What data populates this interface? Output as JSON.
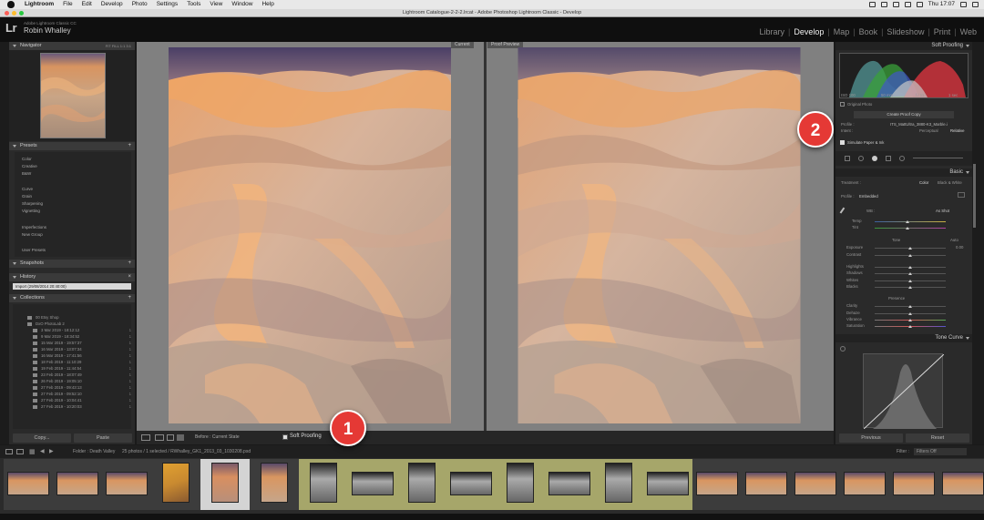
{
  "menubar": {
    "app": "Lightroom",
    "items": [
      "File",
      "Edit",
      "Develop",
      "Photo",
      "Settings",
      "Tools",
      "View",
      "Window",
      "Help"
    ],
    "clock": "Thu 17:07"
  },
  "window": {
    "title": "Lightroom Catalogue-2-2-2.lrcat - Adobe Photoshop Lightroom Classic - Develop"
  },
  "identity": {
    "logo": "Lr",
    "product": "Adobe Lightroom Classic CC",
    "user": "Robin Whalley"
  },
  "modules": [
    "Library",
    "Develop",
    "Map",
    "Book",
    "Slideshow",
    "Print",
    "Web"
  ],
  "active_module": "Develop",
  "left_panel": {
    "navigator": {
      "title": "Navigator",
      "zoom": "FIT   FILL   1:1   3:1"
    },
    "presets": {
      "title": "Presets",
      "groups": [
        [
          "Color",
          "Creative",
          "B&W"
        ],
        [
          "Curve",
          "Grain",
          "Sharpening",
          "Vignetting"
        ],
        [
          "Imperfections",
          "New Group"
        ],
        [
          "User Presets"
        ]
      ]
    },
    "snapshots": {
      "title": "Snapshots"
    },
    "history": {
      "title": "History",
      "item": "Import (29/08/2014 20:40:00)"
    },
    "collections": {
      "title": "Collections",
      "sets": [
        "00 Etsy Shop",
        "DxO PhotoLab 2"
      ],
      "items": [
        {
          "name": "3 Mar 2019 - 18:12:12",
          "count": "1"
        },
        {
          "name": "9 Mar 2019 - 18:34:52",
          "count": "1"
        },
        {
          "name": "15 Mar 2019 - 19:57:37",
          "count": "1"
        },
        {
          "name": "16 Mar 2019 - 13:07:34",
          "count": "1"
        },
        {
          "name": "16 Mar 2019 - 17:41:56",
          "count": "1"
        },
        {
          "name": "18 Feb 2019 - 11:10:29",
          "count": "1"
        },
        {
          "name": "19 Feb 2019 - 11:44:54",
          "count": "1"
        },
        {
          "name": "23 Feb 2019 - 18:07:49",
          "count": "1"
        },
        {
          "name": "26 Feb 2019 - 19:05:10",
          "count": "1"
        },
        {
          "name": "27 Feb 2019 - 09:43:13",
          "count": "1"
        },
        {
          "name": "27 Feb 2019 - 09:52:10",
          "count": "1"
        },
        {
          "name": "27 Feb 2019 - 10:04:41",
          "count": "1"
        },
        {
          "name": "27 Feb 2019 - 10:20:03",
          "count": "1"
        }
      ]
    },
    "copy": "Copy...",
    "paste": "Paste"
  },
  "view": {
    "before_label": "Current",
    "after_label": "Proof Preview"
  },
  "toolbar": {
    "before": "Before : Current State",
    "soft_proofing": "Soft Proofing"
  },
  "right_panel": {
    "soft_proofing_title": "Soft Proofing",
    "histogram_vals": [
      "ISO 100",
      "50 mm",
      "f / 11",
      "1 sec"
    ],
    "original_photo": "Original Photo",
    "create_proof": "Create Proof Copy",
    "profile_label": "Profile :",
    "profile_value": "ITS_MattUltra_3880-K3_Marble.i",
    "intent_label": "Intent :",
    "intent_perceptual": "Perceptual",
    "intent_relative": "Relative",
    "simulate": "Simulate Paper & Ink",
    "basic_title": "Basic",
    "treatment_label": "Treatment :",
    "treatment_color": "Color",
    "treatment_bw": "Black & White",
    "profile2_label": "Profile :",
    "profile2_value": "Embedded",
    "wb_label": "WB :",
    "wb_value": "As Shot",
    "temp": "Temp",
    "tint": "Tint",
    "tone": "Tone",
    "auto": "Auto",
    "exposure": "Exposure",
    "exposure_val": "0.00",
    "contrast": "Contrast",
    "highlights": "Highlights",
    "shadows": "Shadows",
    "whites": "Whites",
    "blacks": "Blacks",
    "presence": "Presence",
    "clarity": "Clarity",
    "dehaze": "Dehaze",
    "vibrance": "Vibrance",
    "saturation": "Saturation",
    "tone_curve_title": "Tone Curve",
    "previous": "Previous",
    "reset": "Reset"
  },
  "filmstrip": {
    "folder": "Folder : Death Valley",
    "info": "25 photos / 1 selected / RWhalley_GK1_2013_03_1030208.psd",
    "filter_label": "Filter :",
    "filter_value": "Filters Off"
  },
  "callouts": [
    "1",
    "2"
  ]
}
